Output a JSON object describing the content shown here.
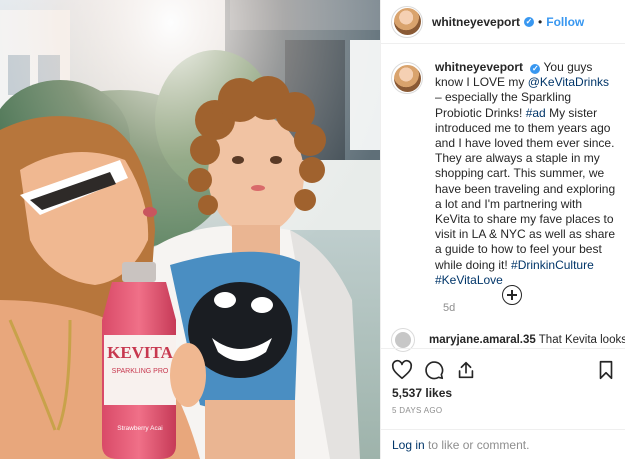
{
  "post": {
    "username": "whitneyeveport",
    "verified_symbol": "✓",
    "separator": "•",
    "follow_label": "Follow",
    "bottle_brand": "KEVITA",
    "bottle_subtitle": "SPARKLING PRO",
    "bottle_flavor": "Strawberry Acai"
  },
  "caption": {
    "username": "whitneyeveport",
    "verified_symbol": "✓",
    "part1": " You guys know I LOVE my ",
    "mention": "@KeVitaDrinks",
    "part2": " – especially the Sparkling Probiotic Drinks! ",
    "hashtag1": "#ad",
    "part3": " My sister introduced me to them years ago and I have loved them ever since. They are always a staple in my shopping cart. This summer, we have been traveling and exploring a lot and I'm partnering with KeVita to share my fave places to visit in LA & NYC as well as share a guide to how to feel your best while doing it! ",
    "hashtag2": "#DrinkinCulture",
    "hashtag3": "#KeVitaLove",
    "time": "5d"
  },
  "comment": {
    "username": "maryjane.amaral.35",
    "text": " That Kevita looks"
  },
  "actions": {
    "likes": "5,537 likes",
    "date": "5 DAYS AGO",
    "login_link": "Log in",
    "login_rest": " to like or comment."
  },
  "icons": [
    "heart-icon",
    "comment-icon",
    "share-icon",
    "bookmark-icon",
    "plus-circle-icon",
    "verified-icon"
  ],
  "colors": {
    "link": "#003569",
    "follow": "#3897f0",
    "meta": "#8e8e8e",
    "text": "#262626"
  }
}
